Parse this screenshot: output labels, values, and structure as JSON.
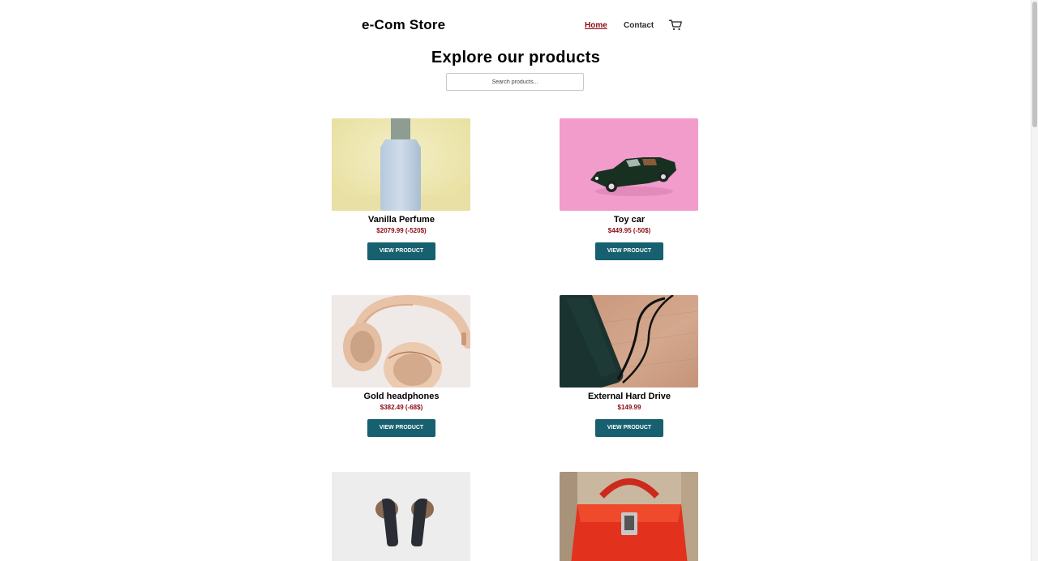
{
  "header": {
    "brand": "e-Com Store",
    "nav": {
      "home": "Home",
      "contact": "Contact"
    },
    "cart_icon": "shopping-cart-icon"
  },
  "hero": {
    "title": "Explore our products",
    "search_placeholder": "Search products..."
  },
  "products": [
    {
      "name": "Vanilla Perfume",
      "price": "$2079.99 (-520$)",
      "button": "VIEW PRODUCT",
      "image": "perfume-bottle-image"
    },
    {
      "name": "Toy car",
      "price": "$449.95 (-50$)",
      "button": "VIEW PRODUCT",
      "image": "toy-car-image"
    },
    {
      "name": "Gold headphones",
      "price": "$382.49 (-68$)",
      "button": "VIEW PRODUCT",
      "image": "headphones-image"
    },
    {
      "name": "External Hard Drive",
      "price": "$149.99",
      "button": "VIEW PRODUCT",
      "image": "hard-drive-image"
    },
    {
      "name": "",
      "price": "",
      "button": "",
      "image": "earbuds-image"
    },
    {
      "name": "",
      "price": "",
      "button": "",
      "image": "red-handbag-image"
    }
  ],
  "colors": {
    "accent_button": "#17606f",
    "price_red": "#8b0a14",
    "nav_active": "#8b0a14"
  }
}
